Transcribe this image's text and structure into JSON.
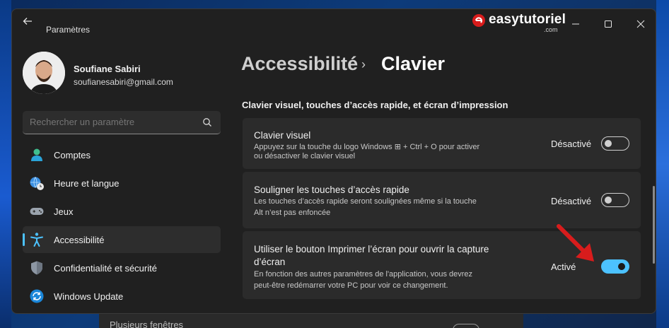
{
  "app": {
    "title": "Paramètres"
  },
  "brand": {
    "text": "easytutoriel",
    "suffix": ".com"
  },
  "window_controls": {
    "minimize": "—",
    "maximize": "☐",
    "close": "✕"
  },
  "user": {
    "name": "Soufiane Sabiri",
    "email": "soufianesabiri@gmail.com"
  },
  "search": {
    "placeholder": "Rechercher un paramètre"
  },
  "nav": {
    "items": [
      {
        "label": "Comptes",
        "icon": "person-icon"
      },
      {
        "label": "Heure et langue",
        "icon": "globe-clock-icon"
      },
      {
        "label": "Jeux",
        "icon": "gamepad-icon"
      },
      {
        "label": "Accessibilité",
        "icon": "accessibility-icon",
        "active": true
      },
      {
        "label": "Confidentialité et sécurité",
        "icon": "shield-icon"
      },
      {
        "label": "Windows Update",
        "icon": "update-icon"
      }
    ]
  },
  "breadcrumb": {
    "parent": "Accessibilité",
    "separator": "›",
    "current": "Clavier"
  },
  "section": {
    "title": "Clavier visuel, touches d’accès rapide, et écran d’impression"
  },
  "settings": [
    {
      "title": "Clavier visuel",
      "description_line1": "Appuyez sur la touche du logo Windows ⊞ + Ctrl + O pour activer",
      "description_line2": "ou désactiver le clavier visuel",
      "state": "Désactivé",
      "on": false
    },
    {
      "title": "Souligner les touches d’accès rapide",
      "description_line1": "Les touches d’accès rapide seront soulignées même si la touche",
      "description_line2": "Alt n’est pas enfoncée",
      "state": "Désactivé",
      "on": false
    },
    {
      "title_line1": "Utiliser le bouton Imprimer l’écran pour ouvrir la capture",
      "title_line2": "d’écran",
      "description_line1": "En fonction des autres paramètres de l'application, vous devrez",
      "description_line2": "peut-être redémarrer votre PC pour voir ce changement.",
      "state": "Activé",
      "on": true
    }
  ],
  "background_window": {
    "label": "Plusieurs fenêtres"
  },
  "colors": {
    "accent": "#4cc2ff",
    "window_bg": "#202020",
    "card_bg": "#2b2b2b",
    "arrow": "#d81c1c"
  }
}
